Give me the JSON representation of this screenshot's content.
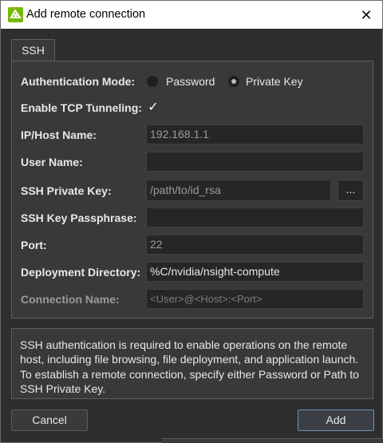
{
  "window": {
    "title": "Add remote connection"
  },
  "tabs": [
    {
      "label": "SSH"
    }
  ],
  "form": {
    "auth_mode": {
      "label": "Authentication Mode:",
      "options": [
        "Password",
        "Private Key"
      ],
      "selected": "Private Key"
    },
    "tcp_tunneling": {
      "label": "Enable TCP Tunneling:",
      "checked": true,
      "check_glyph": "✓"
    },
    "host": {
      "label": "IP/Host Name:",
      "value": "",
      "placeholder": "192.168.1.1"
    },
    "user": {
      "label": "User Name:",
      "value": ""
    },
    "private_key": {
      "label": "SSH Private Key:",
      "value": "",
      "placeholder": "/path/to/id_rsa",
      "browse_label": "..."
    },
    "passphrase": {
      "label": "SSH Key Passphrase:",
      "value": ""
    },
    "port": {
      "label": "Port:",
      "value": "",
      "placeholder": "22"
    },
    "deploy_dir": {
      "label": "Deployment Directory:",
      "value": "%C/nvidia/nsight-compute"
    },
    "connection_name": {
      "label": "Connection Name:",
      "value": "",
      "placeholder": "<User>@<Host>:<Port>"
    }
  },
  "info_text": "SSH authentication is required to enable operations on the remote host, including file browsing, file deployment, and application launch. To establish a remote connection, specify either Password or Path to SSH Private Key.",
  "buttons": {
    "cancel": "Cancel",
    "add": "Add"
  },
  "colors": {
    "brand": "#76b900",
    "background": "#2e2e2e",
    "panel": "#393939",
    "accent_border": "#6f90b9"
  },
  "icons": {
    "app": "nsight-logo-icon",
    "close": "close-icon",
    "check": "checkmark-icon"
  }
}
